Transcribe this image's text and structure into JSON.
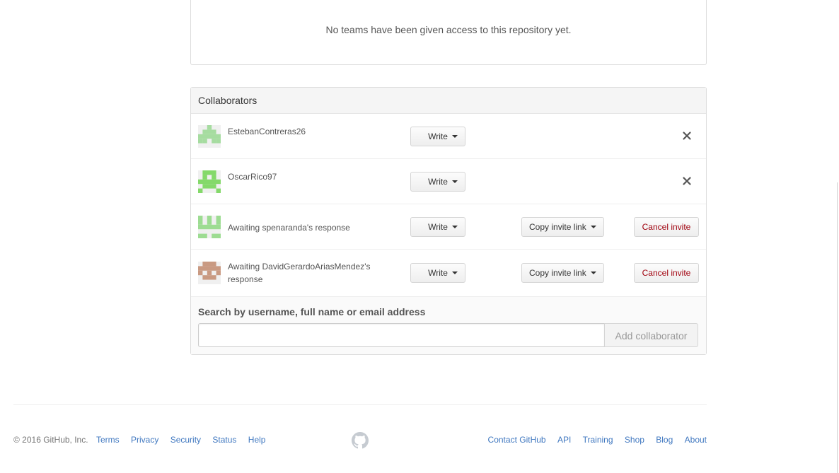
{
  "teams": {
    "empty_message": "No teams have been given access to this repository yet."
  },
  "collaborators": {
    "title": "Collaborators",
    "rows": [
      {
        "username": "EstebanContreras26",
        "permission": "Write",
        "status": "member",
        "avatar_color": "#a6dca0"
      },
      {
        "username": "OscarRico97",
        "permission": "Write",
        "status": "member",
        "avatar_color": "#84d96a"
      },
      {
        "username": "Awaiting spenaranda's response",
        "permission": "Write",
        "status": "pending",
        "copy_label": "Copy invite link",
        "cancel_label": "Cancel invite",
        "avatar_color": "#9ddc92"
      },
      {
        "username": "Awaiting DavidGerardoAriasMendez's response",
        "permission": "Write",
        "status": "pending",
        "copy_label": "Copy invite link",
        "cancel_label": "Cancel invite",
        "avatar_color": "#c99a82"
      }
    ],
    "search": {
      "label": "Search by username, full name or email address",
      "value": "",
      "placeholder": "",
      "add_button": "Add collaborator"
    }
  },
  "footer": {
    "copyright": "© 2016 GitHub, Inc.",
    "left_links": [
      "Terms",
      "Privacy",
      "Security",
      "Status",
      "Help"
    ],
    "right_links": [
      "Contact GitHub",
      "API",
      "Training",
      "Shop",
      "Blog",
      "About"
    ]
  },
  "colors": {
    "link": "#4078c0",
    "danger": "#a0000d",
    "border": "#dddddd"
  },
  "icons": {
    "remove": "close-icon",
    "dropdown": "caret-down-icon",
    "footer_logo": "github-mark-icon"
  }
}
